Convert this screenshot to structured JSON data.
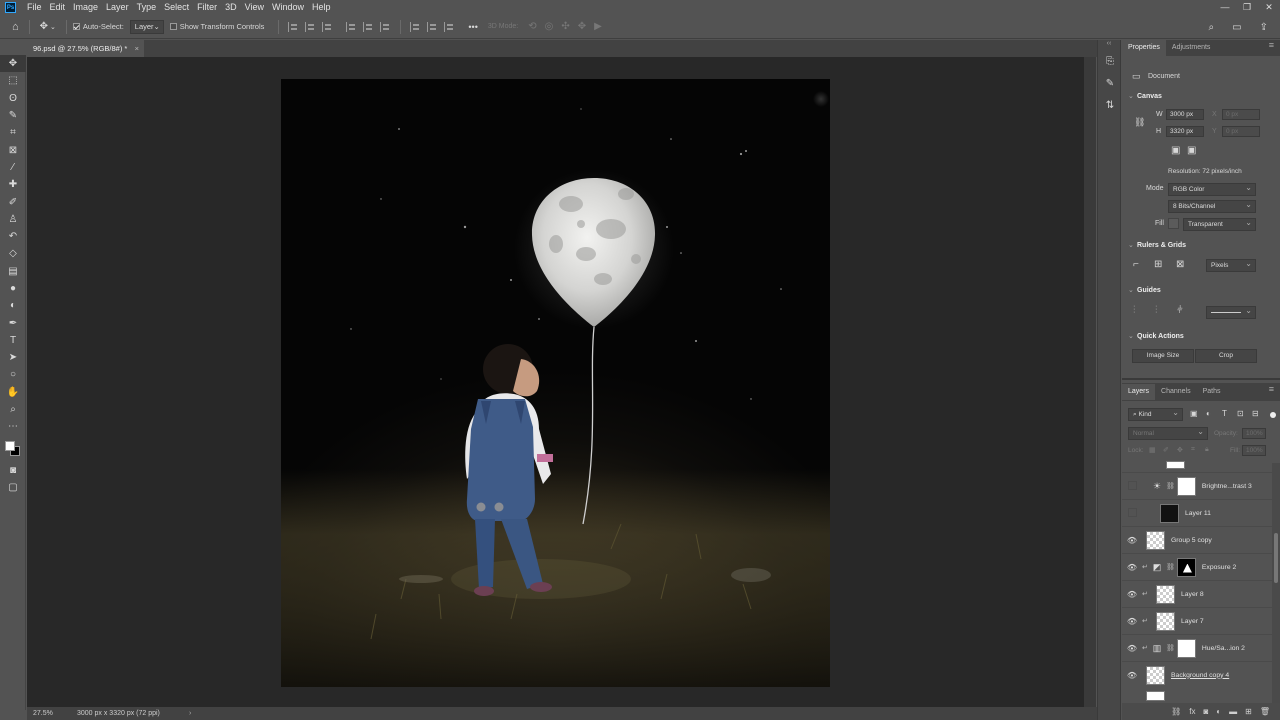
{
  "menu": [
    "File",
    "Edit",
    "Image",
    "Layer",
    "Type",
    "Select",
    "Filter",
    "3D",
    "View",
    "Window",
    "Help"
  ],
  "app_logo": "Ps",
  "window_controls": [
    "—",
    "❐",
    "✕"
  ],
  "options_bar": {
    "auto_select_label": "Auto-Select:",
    "auto_select_checked": true,
    "auto_select_target": "Layer",
    "transform_controls_label": "Show Transform Controls",
    "transform_controls_checked": false,
    "more_label": "•••",
    "mode_3d_label": "3D Mode:"
  },
  "document_tab": {
    "title": "96.psd @ 27.5% (RGB/8#) *",
    "close": "×"
  },
  "status_bar": {
    "zoom": "27.5%",
    "info": "3000 px x 3320 px (72 ppi)",
    "arrow": "›"
  },
  "tools": [
    "move-tool",
    "marquee-tool",
    "lasso-tool",
    "quick-select-tool",
    "crop-tool",
    "frame-tool",
    "eyedropper-tool",
    "healing-tool",
    "brush-tool",
    "stamp-tool",
    "history-brush-tool",
    "eraser-tool",
    "gradient-tool",
    "blur-tool",
    "dodge-tool",
    "pen-tool",
    "type-tool",
    "path-select-tool",
    "shape-tool",
    "hand-tool",
    "zoom-tool",
    "more-tools"
  ],
  "properties": {
    "tabs": [
      "Properties",
      "Adjustments"
    ],
    "doc_label": "Document",
    "canvas_title": "Canvas",
    "w_label": "W",
    "w_value": "3000 px",
    "h_label": "H",
    "h_value": "3320 px",
    "x_label": "X",
    "x_value": "0 px",
    "y_label": "Y",
    "y_value": "0 px",
    "resolution": "Resolution: 72 pixels/inch",
    "mode_label": "Mode",
    "mode_value": "RGB Color",
    "bits_value": "8 Bits/Channel",
    "fill_label": "Fill",
    "fill_value": "Transparent",
    "rulers_title": "Rulers & Grids",
    "units_value": "Pixels",
    "guides_title": "Guides",
    "quick_actions_title": "Quick Actions",
    "image_size_btn": "Image Size",
    "crop_btn": "Crop"
  },
  "layers_panel": {
    "tabs": [
      "Layers",
      "Channels",
      "Paths"
    ],
    "filter_value": "Kind",
    "blend_mode": "Normal",
    "opacity_label": "Opacity:",
    "opacity_value": "100%",
    "lock_label": "Lock:",
    "fill_label": "Fill:",
    "fill_value": "100%",
    "layers": [
      {
        "name": "Brightne...trast 3",
        "visible": false
      },
      {
        "name": "Layer 11",
        "visible": false
      },
      {
        "name": "Group 5 copy",
        "visible": true
      },
      {
        "name": "Exposure 2",
        "visible": true
      },
      {
        "name": "Layer 8",
        "visible": true
      },
      {
        "name": "Layer 7",
        "visible": true
      },
      {
        "name": "Hue/Sa...ion 2",
        "visible": true
      },
      {
        "name": "Background copy 4",
        "visible": true
      }
    ]
  }
}
